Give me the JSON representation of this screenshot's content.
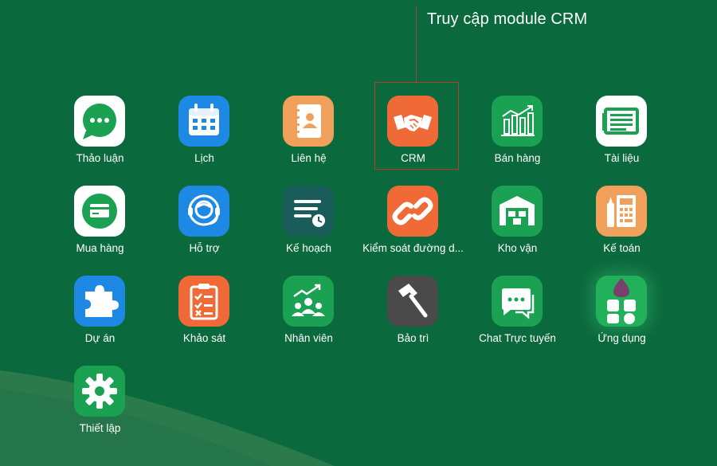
{
  "annotation": {
    "text": "Truy cập module CRM",
    "color": "#c0392b"
  },
  "background_color": "#0b6a3d",
  "apps": [
    {
      "label": "Thảo luận",
      "icon": "chat-bubble-icon",
      "color": "#ffffff"
    },
    {
      "label": "Lịch",
      "icon": "calendar-icon",
      "color": "#1e88e5"
    },
    {
      "label": "Liên hệ",
      "icon": "contact-book-icon",
      "color": "#f0a05a"
    },
    {
      "label": "CRM",
      "icon": "handshake-icon",
      "color": "#ef6a37"
    },
    {
      "label": "Bán hàng",
      "icon": "sales-chart-icon",
      "color": "#1aa152"
    },
    {
      "label": "Tài liệu",
      "icon": "document-icon",
      "color": "#ffffff"
    },
    {
      "label": "Mua hàng",
      "icon": "credit-card-icon",
      "color": "#ffffff"
    },
    {
      "label": "Hỗ trợ",
      "icon": "support-agent-icon",
      "color": "#1e88e5"
    },
    {
      "label": "Kế hoạch",
      "icon": "plan-list-clock-icon",
      "color": "#1a5c5a"
    },
    {
      "label": "Kiểm soát đường d...",
      "icon": "link-icon",
      "color": "#ef6a37"
    },
    {
      "label": "Kho vận",
      "icon": "warehouse-icon",
      "color": "#1aa152"
    },
    {
      "label": "Kế toán",
      "icon": "accounting-icon",
      "color": "#f0a05a"
    },
    {
      "label": "Dự án",
      "icon": "puzzle-icon",
      "color": "#1e88e5"
    },
    {
      "label": "Khảo sát",
      "icon": "survey-clipboard-icon",
      "color": "#ef6a37"
    },
    {
      "label": "Nhân viên",
      "icon": "employees-icon",
      "color": "#1aa152"
    },
    {
      "label": "Bảo trì",
      "icon": "hammer-icon",
      "color": "#4a4a4a"
    },
    {
      "label": "Chat Trực tuyến",
      "icon": "live-chat-icon",
      "color": "#1aa152"
    },
    {
      "label": "Ứng dụng",
      "icon": "apps-grid-icon",
      "color": "#21b15a"
    },
    {
      "label": "Thiết lập",
      "icon": "gear-icon",
      "color": "#1aa152"
    }
  ]
}
